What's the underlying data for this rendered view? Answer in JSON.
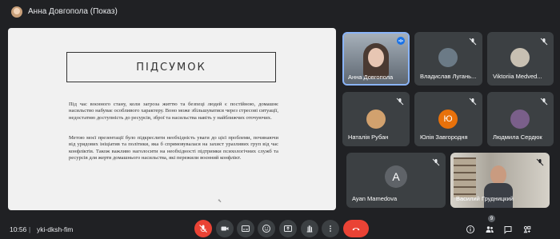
{
  "header": {
    "presenter_label": "Анна Довгопола (Показ)"
  },
  "slide": {
    "title": "ПІДСУМОК",
    "paragraph1": "Під час воєнного стану, коли загроза життю та безпеці людей є постійною, домашнє насильство набуває особливого характеру. Воно може збільшуватися через стресові ситуації, недостатню доступність до ресурсів, зброї та насильства навіть у найближчих оточуючих.",
    "paragraph2": "Метою моєї презентації було підкреслити необхідність уваги до цієї проблеми, починаючи від урядових ініціатив та політики, яка б спрямовувалася на захист уразливих груп від час конфліктів. Також важливо наголосити на необхідності підтримки психологічних служб та ресурсів для жертв домашнього насильства, які пережили воєнний конфлікт."
  },
  "participants": [
    {
      "name": "Анна Довгопола",
      "initial": "",
      "avatar_color": "#e7c6b3",
      "active": true
    },
    {
      "name": "Владислав Лугань...",
      "initial": "",
      "avatar_color": "#6b7a86"
    },
    {
      "name": "Viktoriia Medved...",
      "initial": "",
      "avatar_color": "#c8c0b2"
    },
    {
      "name": "Наталія Рубан",
      "initial": "",
      "avatar_color": "#d1a16e"
    },
    {
      "name": "Юлія Завгородня",
      "initial": "Ю",
      "avatar_color": "#e8710a"
    },
    {
      "name": "Людмила Сердюк",
      "initial": "",
      "avatar_color": "#7a5f8a"
    },
    {
      "name": "Ayan Mamedova",
      "initial": "A",
      "avatar_color": "#5f6368"
    },
    {
      "name": "Василий Грудницкий",
      "initial": "",
      "avatar_color": "#8a7a6a"
    }
  ],
  "bottom_bar": {
    "time": "10:56",
    "separator": "|",
    "meeting_code": "yki-dksh-fim",
    "people_count": "9"
  },
  "colors": {
    "end_call": "#ea4335",
    "mic_off": "#ea4335",
    "accent": "#8ab4f8",
    "bg": "#202124",
    "tile": "#3c4043"
  },
  "icons": [
    "mic-off-icon",
    "camera-icon",
    "captions-icon",
    "emoji-icon",
    "present-icon",
    "raise-hand-icon",
    "more-icon",
    "end-call-icon",
    "info-icon",
    "people-icon",
    "chat-icon",
    "activities-icon"
  ]
}
